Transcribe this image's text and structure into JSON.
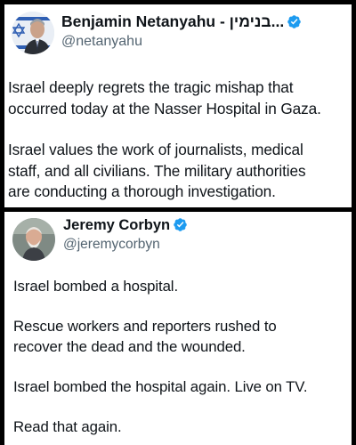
{
  "posts": [
    {
      "display_name": "Benjamin Netanyahu - בנימין...",
      "handle": "@netanyahu",
      "verified": true,
      "paragraphs": [
        "Israel deeply regrets the tragic mishap that\noccurred today at the Nasser Hospital in Gaza.",
        "Israel values the work of journalists, medical\nstaff, and all civilians. The military authorities\nare conducting a thorough investigation."
      ]
    },
    {
      "display_name": "Jeremy Corbyn",
      "handle": "@jeremycorbyn",
      "verified": true,
      "paragraphs": [
        "Israel bombed a hospital.",
        "Rescue workers and reporters rushed to\nrecover the dead and the wounded.",
        "Israel bombed the hospital again. Live on TV.",
        "Read that again."
      ]
    }
  ],
  "colors": {
    "verified_badge": "#1d9bf0",
    "handle_text": "#536471",
    "body_text": "#0f1419"
  },
  "icons": {
    "verified": "verified-badge-icon"
  }
}
